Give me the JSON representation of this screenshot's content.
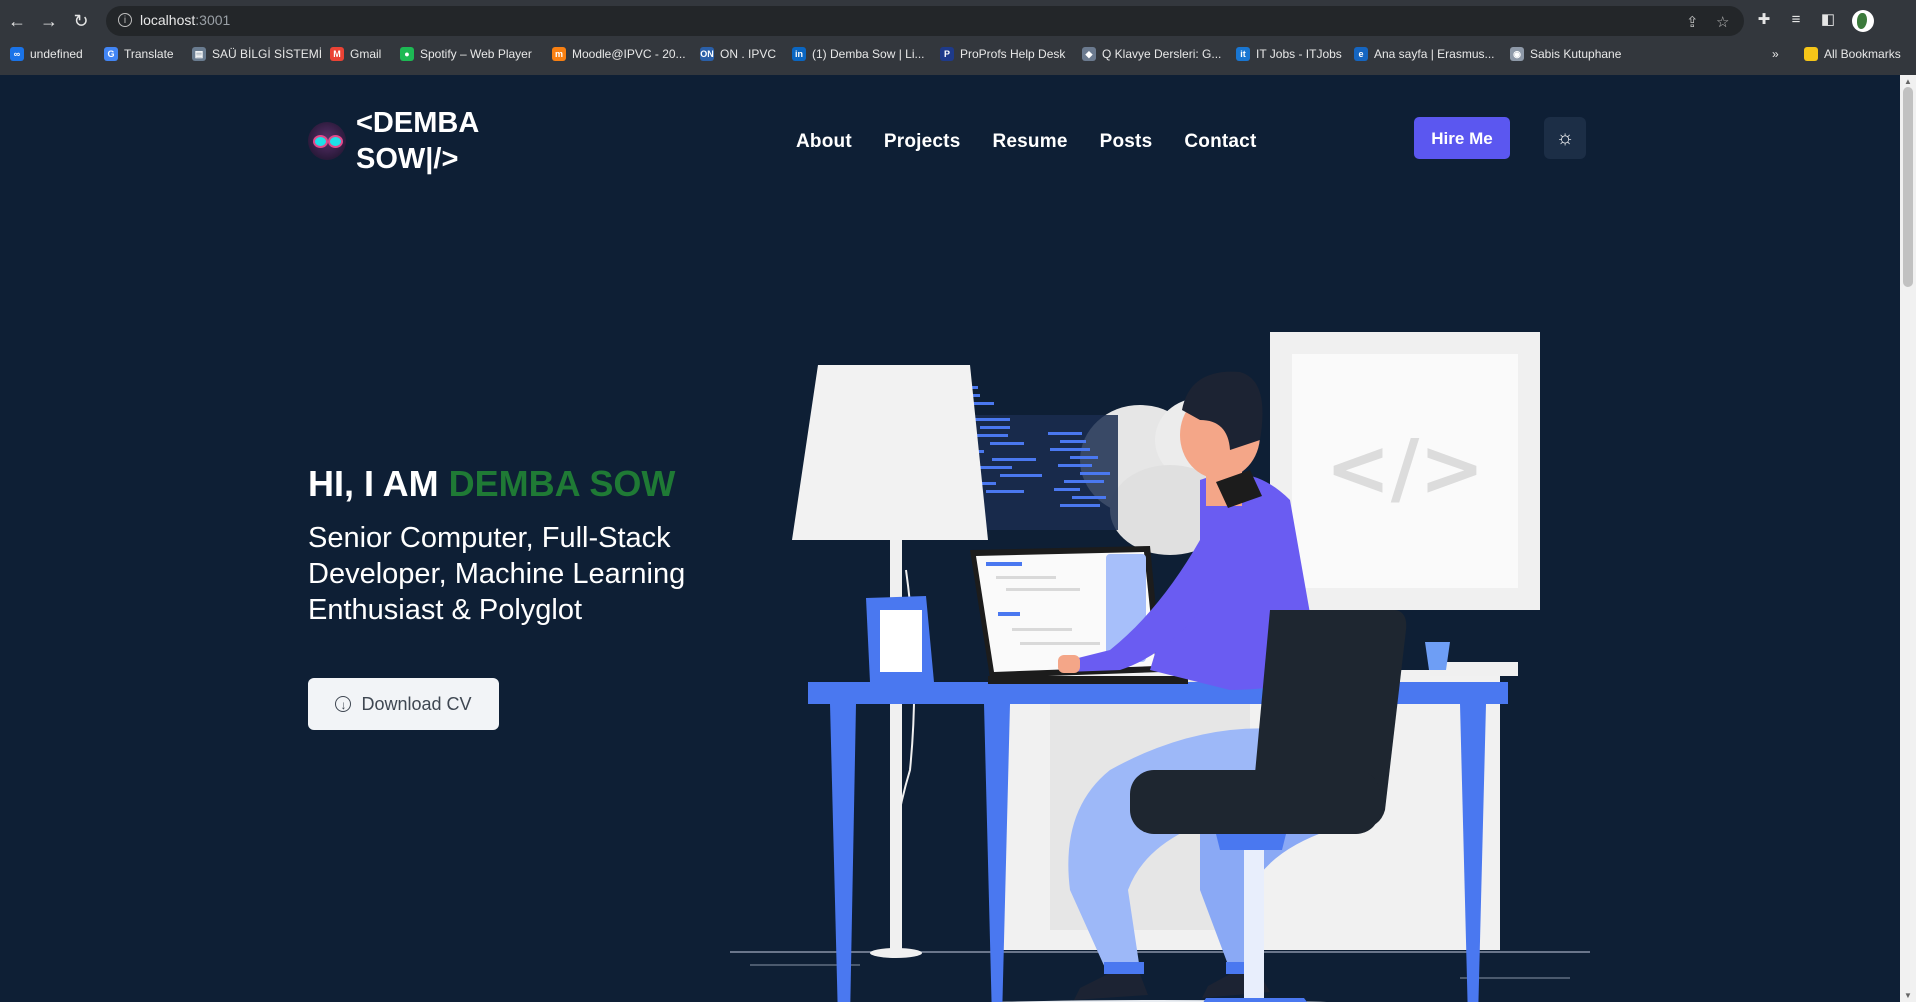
{
  "browser": {
    "url_host": "localhost",
    "url_port": ":3001",
    "bookmarks": [
      {
        "label": "undefined",
        "color": "#1a73e8",
        "glyph": "∞"
      },
      {
        "label": "Translate",
        "color": "#4285f4",
        "glyph": "G"
      },
      {
        "label": "SAÜ BİLGİ SİSTEMİ",
        "color": "#6a7c90",
        "glyph": "▤"
      },
      {
        "label": "Gmail",
        "color": "#ea4335",
        "glyph": "M"
      },
      {
        "label": "Spotify – Web Player",
        "color": "#1db954",
        "glyph": "●"
      },
      {
        "label": "Moodle@IPVC - 20...",
        "color": "#f98012",
        "glyph": "m"
      },
      {
        "label": "ON . IPVC",
        "color": "#2a5fa8",
        "glyph": "ON"
      },
      {
        "label": "(1) Demba Sow | Li...",
        "color": "#0a66c2",
        "glyph": "in"
      },
      {
        "label": "ProProfs Help Desk",
        "color": "#1e3a8a",
        "glyph": "P"
      },
      {
        "label": "Q Klavye Dersleri: G...",
        "color": "#6b7a8f",
        "glyph": "◆"
      },
      {
        "label": "IT Jobs - ITJobs",
        "color": "#1976d2",
        "glyph": "it"
      },
      {
        "label": "Ana sayfa | Erasmus...",
        "color": "#1565c0",
        "glyph": "e"
      },
      {
        "label": "Sabis Kutuphane",
        "color": "#8e99a8",
        "glyph": "◉"
      }
    ],
    "more_label": "»",
    "all_bookmarks_label": "All Bookmarks"
  },
  "header": {
    "logo_line1": "<DEMBA",
    "logo_line2": "SOW|/>",
    "nav": [
      "About",
      "Projects",
      "Resume",
      "Posts",
      "Contact"
    ],
    "hire_label": "Hire Me"
  },
  "hero": {
    "greeting": "HI, I AM ",
    "name": "DEMBA SOW",
    "subtitle": "Senior Computer, Full-Stack Developer, Machine Learning Enthusiast & Polyglot",
    "cv_label": "Download CV"
  },
  "colors": {
    "page_bg": "#0e1f35",
    "accent_name": "#1f7a35",
    "hire_button": "#5b57f0",
    "desk_blue": "#4a78f0"
  },
  "illustration": {
    "monitor_code": "</>"
  }
}
